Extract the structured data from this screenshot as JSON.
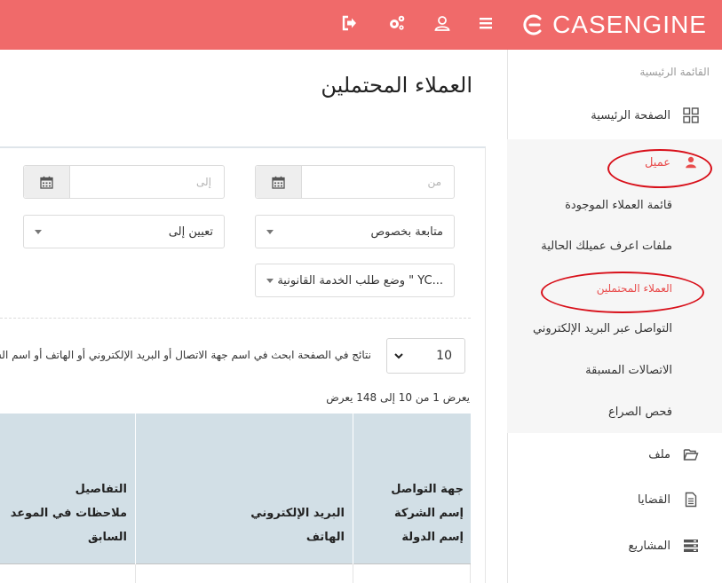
{
  "brand": {
    "name": "CASENGINE",
    "color": "#f06a6a"
  },
  "topbar": {
    "icons": [
      "menu-icon",
      "user-icon",
      "settings-icon",
      "logout-icon"
    ]
  },
  "sidebar": {
    "heading": "القائمة الرئيسية",
    "items": [
      {
        "label": "الصفحة الرئيسية",
        "icon": "grid-icon"
      },
      {
        "label": "عميل",
        "icon": "user-icon",
        "active": true
      },
      {
        "label": "ملف",
        "icon": "folder-icon"
      },
      {
        "label": "القضايا",
        "icon": "document-icon"
      },
      {
        "label": "المشاريع",
        "icon": "server-icon"
      }
    ],
    "sub_items": [
      {
        "label": "قائمة العملاء الموجودة"
      },
      {
        "label": "ملفات اعرف عميلك الحالية"
      },
      {
        "label": "العملاء المحتملين",
        "active": true
      },
      {
        "label": "التواصل عبر البريد الإلكتروني"
      },
      {
        "label": "الاتصالات المسبقة"
      },
      {
        "label": "فحص الصراع"
      }
    ],
    "active_color": "#e84c4c",
    "annotation_color": "#d8101a"
  },
  "page": {
    "title": "العملاء المحتملين"
  },
  "filters": {
    "from_placeholder": "من",
    "to_placeholder": "إلى",
    "follow_up": "متابعة بخصوص",
    "assign_to": "تعيين إلى",
    "legal_service_status": "وضع طلب الخدمة القانونية \" YC..."
  },
  "table_controls": {
    "page_size": "10",
    "search_hint": "نتائج في الصفحة  ابحث في اسم جهة الاتصال أو البريد الإلكتروني أو الهاتف أو اسم الشركة",
    "showing": "يعرض 1 من 10 إلى 148 يعرض"
  },
  "table": {
    "headers": [
      {
        "lines": [
          "جهة التواصل",
          "إسم الشركة",
          "إسم الدولة"
        ]
      },
      {
        "lines": [
          "البريد الإلكتروني",
          "الهاتف"
        ]
      },
      {
        "lines": [
          "التفاصيل",
          "ملاحظات في الموعد",
          "السابق"
        ]
      }
    ],
    "header_color": "#d2dfe6"
  }
}
